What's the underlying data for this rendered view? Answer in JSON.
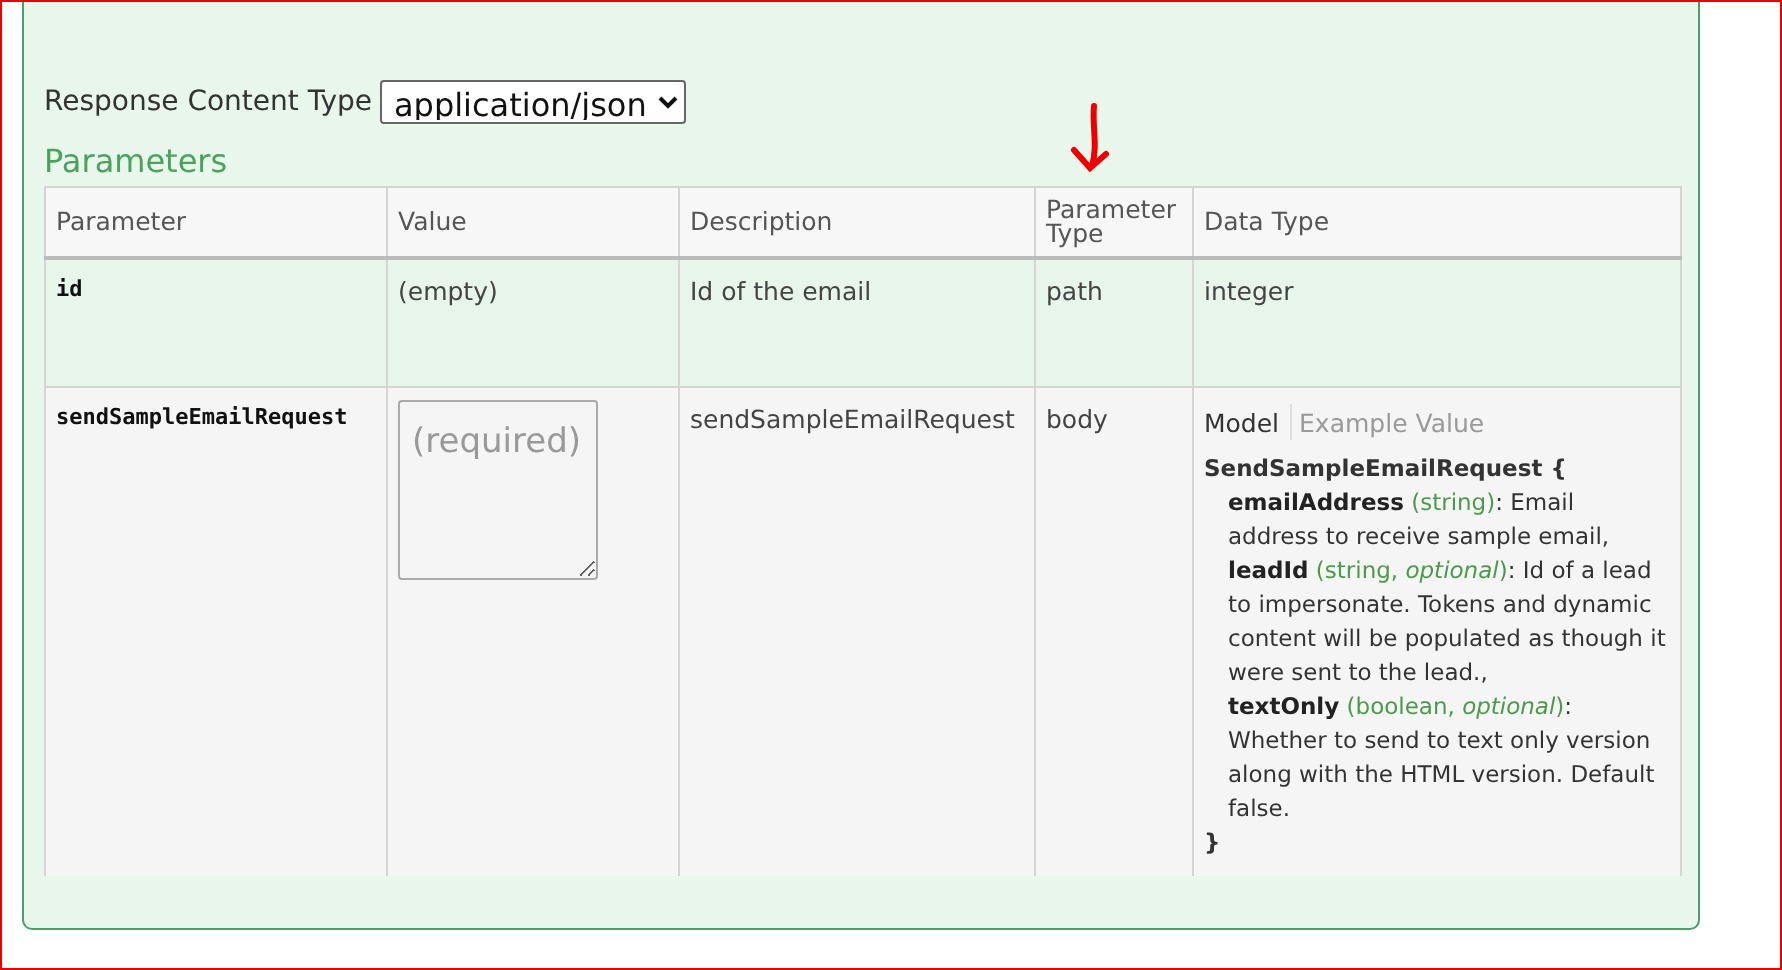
{
  "response_content_type": {
    "label": "Response Content Type",
    "value": "application/json"
  },
  "parameters": {
    "title": "Parameters",
    "columns": [
      "Parameter",
      "Value",
      "Description",
      "Parameter Type",
      "Data Type"
    ],
    "rows": [
      {
        "name": "id",
        "value": {
          "kind": "text",
          "text": "(empty)"
        },
        "description": "Id of the email",
        "parameter_type": "path",
        "data_type": {
          "kind": "text",
          "text": "integer"
        }
      },
      {
        "name": "sendSampleEmailRequest",
        "value": {
          "kind": "textarea",
          "placeholder": "(required)"
        },
        "description": "sendSampleEmailRequest",
        "parameter_type": "body",
        "data_type": {
          "kind": "model",
          "tabs": [
            {
              "label": "Model",
              "selected": true
            },
            {
              "label": "Example Value",
              "selected": false
            }
          ],
          "model_name": "SendSampleEmailRequest {",
          "properties": [
            {
              "name": "emailAddress",
              "type": "(string)",
              "description": ": Email address to receive sample email,"
            },
            {
              "name": "leadId",
              "type": "(string, *optional*)",
              "description": ": Id of a lead to impersonate. Tokens and dynamic content will be populated as though it were sent to the lead.,"
            },
            {
              "name": "textOnly",
              "type": "(boolean, *optional*)",
              "description": ": Whether to send to text only version along with the HTML version. Default false."
            }
          ],
          "close": "}"
        }
      }
    ]
  }
}
